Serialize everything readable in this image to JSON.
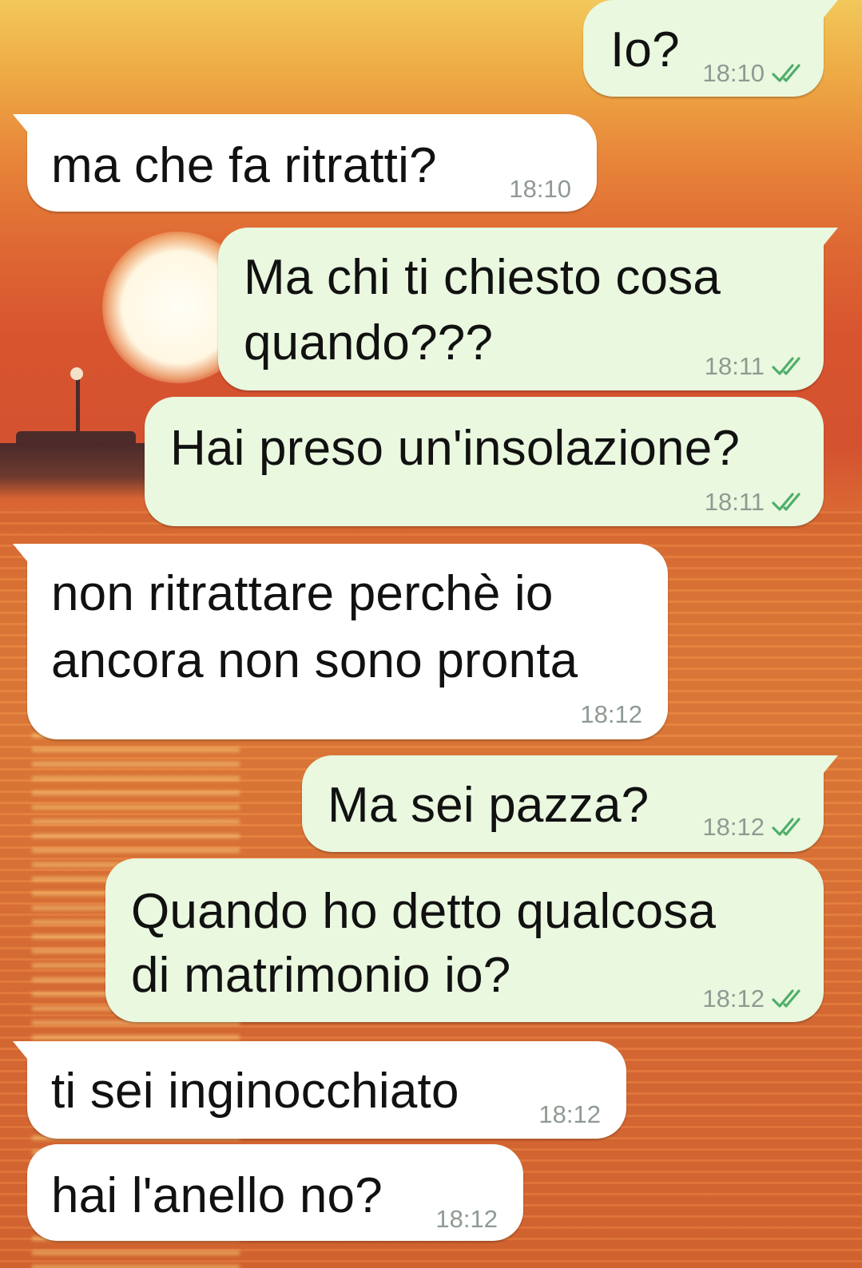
{
  "chat": {
    "messages": [
      {
        "direction": "outgoing",
        "lines": [
          "Io?"
        ],
        "time": "18:10",
        "status_icon": "double-check-icon"
      },
      {
        "direction": "incoming",
        "lines": [
          "ma che fa ritratti?"
        ],
        "time": "18:10"
      },
      {
        "direction": "outgoing",
        "lines": [
          "Ma chi ti chiesto cosa",
          "quando???"
        ],
        "time": "18:11",
        "status_icon": "double-check-icon"
      },
      {
        "direction": "outgoing",
        "lines": [
          "Hai preso un'insolazione?"
        ],
        "time": "18:11",
        "status_icon": "double-check-icon"
      },
      {
        "direction": "incoming",
        "lines": [
          "non ritrattare perchè io",
          "ancora non sono pronta"
        ],
        "time": "18:12"
      },
      {
        "direction": "outgoing",
        "lines": [
          "Ma sei pazza?"
        ],
        "time": "18:12",
        "status_icon": "double-check-icon"
      },
      {
        "direction": "outgoing",
        "lines": [
          "Quando ho detto qualcosa",
          "di matrimonio io?"
        ],
        "time": "18:12",
        "status_icon": "double-check-icon"
      },
      {
        "direction": "incoming",
        "lines": [
          "ti sei inginocchiato"
        ],
        "time": "18:12"
      },
      {
        "direction": "incoming",
        "lines": [
          "hai l'anello no?"
        ],
        "time": "18:12"
      }
    ]
  },
  "colors": {
    "outgoing_bubble": "#e9f8df",
    "incoming_bubble": "#ffffff",
    "timestamp": "#8f9a92",
    "read_ticks": "#4fae6a"
  },
  "wallpaper": {
    "type": "sunset-over-sea"
  }
}
